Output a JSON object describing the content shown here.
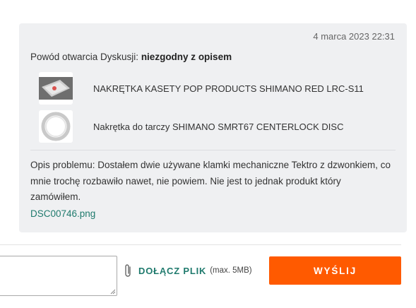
{
  "message": {
    "timestamp": "4 marca 2023 22:31",
    "reason_label": "Powód otwarcia Dyskusji: ",
    "reason_value": "niezgodny z opisem",
    "products": [
      {
        "name": "NAKRĘTKA KASETY POP PRODUCTS SHIMANO RED LRC-S11"
      },
      {
        "name": "Nakrętka do tarczy SHIMANO SMRT67 CENTERLOCK DISC"
      }
    ],
    "problem_text": "Opis problemu: Dostałem dwie używane klamki mechaniczne Tektro z dzwonkiem, co mnie trochę rozbawiło nawet, nie powiem. Nie jest to jednak produkt który zamówiłem.",
    "attachment_name": "DSC00746.png"
  },
  "reply": {
    "attach_label": "DOŁĄCZ PLIK",
    "attach_limit": "(max. 5MB)",
    "send_label": "WYŚLIJ"
  },
  "colors": {
    "card_bg": "#eff0f2",
    "accent_green": "#1f7a6d",
    "send_button": "#ff5a00"
  }
}
